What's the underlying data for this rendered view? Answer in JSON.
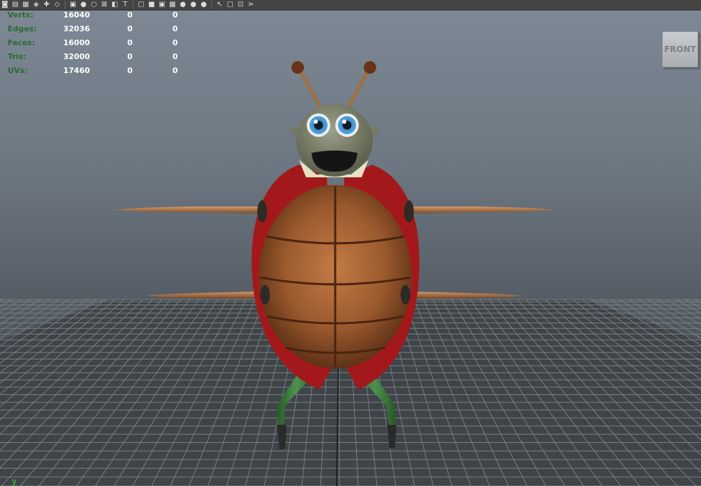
{
  "toolbar": {
    "icons": [
      {
        "name": "camera-attributes-icon",
        "glyph": "◙"
      },
      {
        "name": "camera-tools-icon",
        "glyph": "▤"
      },
      {
        "name": "image-plane-icon",
        "glyph": "▦"
      },
      {
        "name": "bookmark-icon",
        "glyph": "◈"
      },
      {
        "name": "film-gate-icon",
        "glyph": "✚"
      },
      {
        "name": "grid-toggle-icon",
        "glyph": "◇"
      },
      {
        "name": "safe-action-icon",
        "glyph": "▣"
      },
      {
        "name": "sphere-shade-icon",
        "glyph": "●"
      },
      {
        "name": "isolate-select-icon",
        "glyph": "○"
      },
      {
        "name": "xray-icon",
        "glyph": "⊠"
      },
      {
        "name": "xray-joints-icon",
        "glyph": "◧"
      },
      {
        "name": "texture-icon",
        "glyph": "T"
      },
      {
        "name": "wireframe-cube-icon",
        "glyph": "▢"
      },
      {
        "name": "smooth-shade-cube-icon",
        "glyph": "■"
      },
      {
        "name": "wireframe-on-shaded-icon",
        "glyph": "▣"
      },
      {
        "name": "textured-icon",
        "glyph": "▩"
      },
      {
        "name": "use-default-light-icon",
        "glyph": "●"
      },
      {
        "name": "all-lights-icon",
        "glyph": "●"
      },
      {
        "name": "shadows-icon",
        "glyph": "●"
      },
      {
        "name": "select-camera-icon",
        "glyph": "↖"
      },
      {
        "name": "hud-cube-icon",
        "glyph": "▢"
      },
      {
        "name": "resolution-gate-icon",
        "glyph": "⊡"
      },
      {
        "name": "share-icon",
        "glyph": "⋗"
      }
    ]
  },
  "hud": {
    "rows": [
      {
        "label": "Verts:",
        "v1": "16040",
        "v2": "0",
        "v3": "0"
      },
      {
        "label": "Edges:",
        "v1": "32036",
        "v2": "0",
        "v3": "0"
      },
      {
        "label": "Faces:",
        "v1": "16000",
        "v2": "0",
        "v3": "0"
      },
      {
        "label": "Tris:",
        "v1": "32000",
        "v2": "0",
        "v3": "0"
      },
      {
        "label": "UVs:",
        "v1": "17460",
        "v2": "0",
        "v3": "0"
      }
    ]
  },
  "viewcube": {
    "label": "FRONT"
  },
  "axis": {
    "y_label": "y"
  },
  "colors": {
    "shell": "#9b5a2e",
    "wing_red": "#a3191b",
    "head": "#767a62",
    "legs": "#3c7b3c",
    "grid_bg": "#3f4448",
    "grid_line": "#7a7f84",
    "hud_label": "#2a6b32"
  }
}
